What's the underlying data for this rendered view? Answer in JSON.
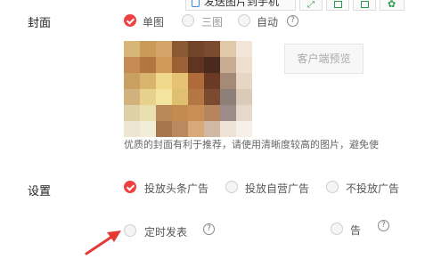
{
  "toolbar": {
    "send_label": "发送图片到手机",
    "icons": [
      "phone-icon",
      "expand-icon",
      "home-icon",
      "share-icon",
      "settings-icon"
    ]
  },
  "cover": {
    "label": "封面",
    "options": [
      {
        "label": "单图",
        "selected": true
      },
      {
        "label": "三图",
        "selected": false
      },
      {
        "label": "自动",
        "selected": false
      }
    ],
    "preview_button": "客户端预览",
    "tip": "优质的封面有利于推荐，请使用清晰度较高的图片，避免使",
    "mosaic_colors": [
      "#d8b67a",
      "#c99a58",
      "#d3a368",
      "#8a5a35",
      "#6f4429",
      "#7a4b2f",
      "#e0c8a8",
      "#f3e6d8",
      "#c58b52",
      "#b27741",
      "#cf9a55",
      "#9c6134",
      "#5f3522",
      "#4a2a1d",
      "#c9ad93",
      "#efdfcf",
      "#caa060",
      "#d9b46c",
      "#f0d98a",
      "#e6c272",
      "#b06b3a",
      "#6b3a25",
      "#a58a77",
      "#e8d6c4",
      "#d2b27c",
      "#e8d18c",
      "#f3e4a0",
      "#e0bf70",
      "#b47744",
      "#7c4a31",
      "#8e7f78",
      "#dccab8",
      "#dfd0a8",
      "#e9e0b0",
      "#b98957",
      "#c48b4f",
      "#c88e55",
      "#b6855e",
      "#9c8b86",
      "#e6d8ca",
      "#eee6d0",
      "#f2edd6",
      "#a6764d",
      "#b98a5d",
      "#d7a978",
      "#cfb9a5",
      "#ece2d6",
      "#f6efe7"
    ]
  },
  "settings": {
    "label": "设置",
    "ad_options": [
      {
        "label": "投放头条广告",
        "selected": true
      },
      {
        "label": "投放自营广告",
        "selected": false
      },
      {
        "label": "不投放广告",
        "selected": false
      }
    ],
    "schedule_label": "定时发表",
    "partial_label": "告",
    "accent": "#f04142"
  }
}
